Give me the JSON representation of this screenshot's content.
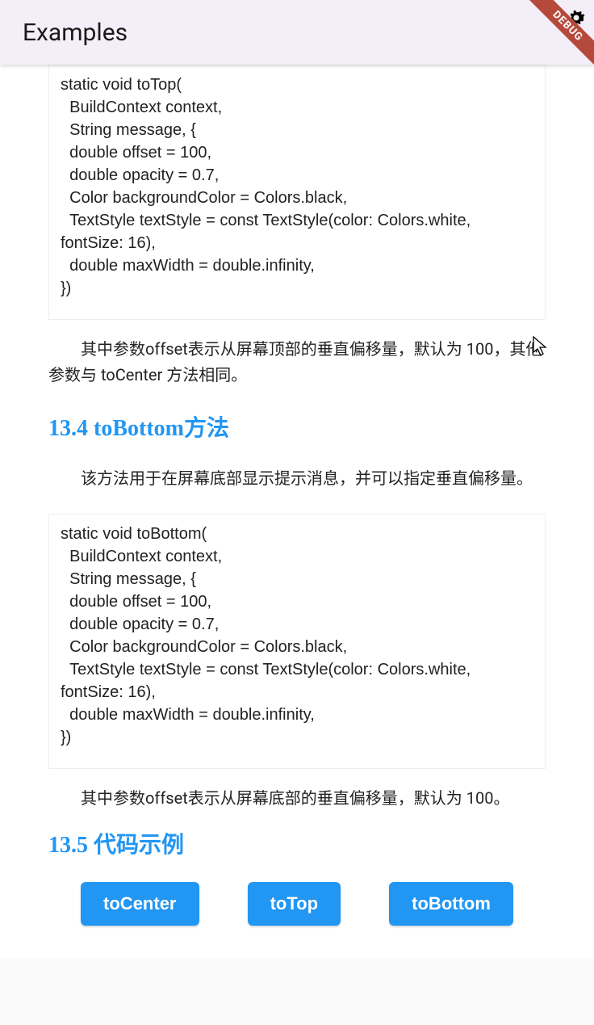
{
  "appbar": {
    "title": "Examples"
  },
  "debug": {
    "label": "DEBUG"
  },
  "code1": "static void toTop(\n  BuildContext context,\n  String message, {\n  double offset = 100,\n  double opacity = 0.7,\n  Color backgroundColor = Colors.black,\n  TextStyle textStyle = const TextStyle(color: Colors.white, fontSize: 16),\n  double maxWidth = double.infinity,\n})",
  "para1": "其中参数offset表示从屏幕顶部的垂直偏移量，默认为 100，其他参数与 toCenter 方法相同。",
  "heading1": "13.4 toBottom方法",
  "para2": "该方法用于在屏幕底部显示提示消息，并可以指定垂直偏移量。",
  "code2": "static void toBottom(\n  BuildContext context,\n  String message, {\n  double offset = 100,\n  double opacity = 0.7,\n  Color backgroundColor = Colors.black,\n  TextStyle textStyle = const TextStyle(color: Colors.white, fontSize: 16),\n  double maxWidth = double.infinity,\n})",
  "para3": "其中参数offset表示从屏幕底部的垂直偏移量，默认为 100。",
  "heading2": "13.5 代码示例",
  "buttons": {
    "toCenter": "toCenter",
    "toTop": "toTop",
    "toBottom": "toBottom"
  }
}
